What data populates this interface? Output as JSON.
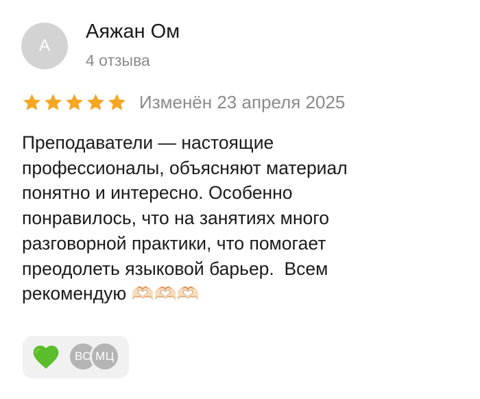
{
  "author": {
    "initial": "А",
    "name": "Аяжан Ом",
    "reviews_count": "4 отзыва"
  },
  "rating": {
    "stars": 5,
    "max_stars": 5,
    "star_color": "#f5a623",
    "edited_label": "Изменён 23 апреля 2025"
  },
  "review": {
    "text": "Преподаватели — настоящие\nпрофессионалы, объясняют материал\nпонятно и интересно. Особенно\nпонравилось, что на занятиях много\nразговорной практики, что помогает\nпреодолеть языковой барьер.  Всем\nрекомендую 🫶🏻🫶🏻🫶🏻"
  },
  "reactions": {
    "emoji_icon": "green-heart-icon",
    "heart_color": "#5bbd2b",
    "reactors": [
      {
        "initials": "ВС"
      },
      {
        "initials": "МЦ"
      }
    ]
  }
}
